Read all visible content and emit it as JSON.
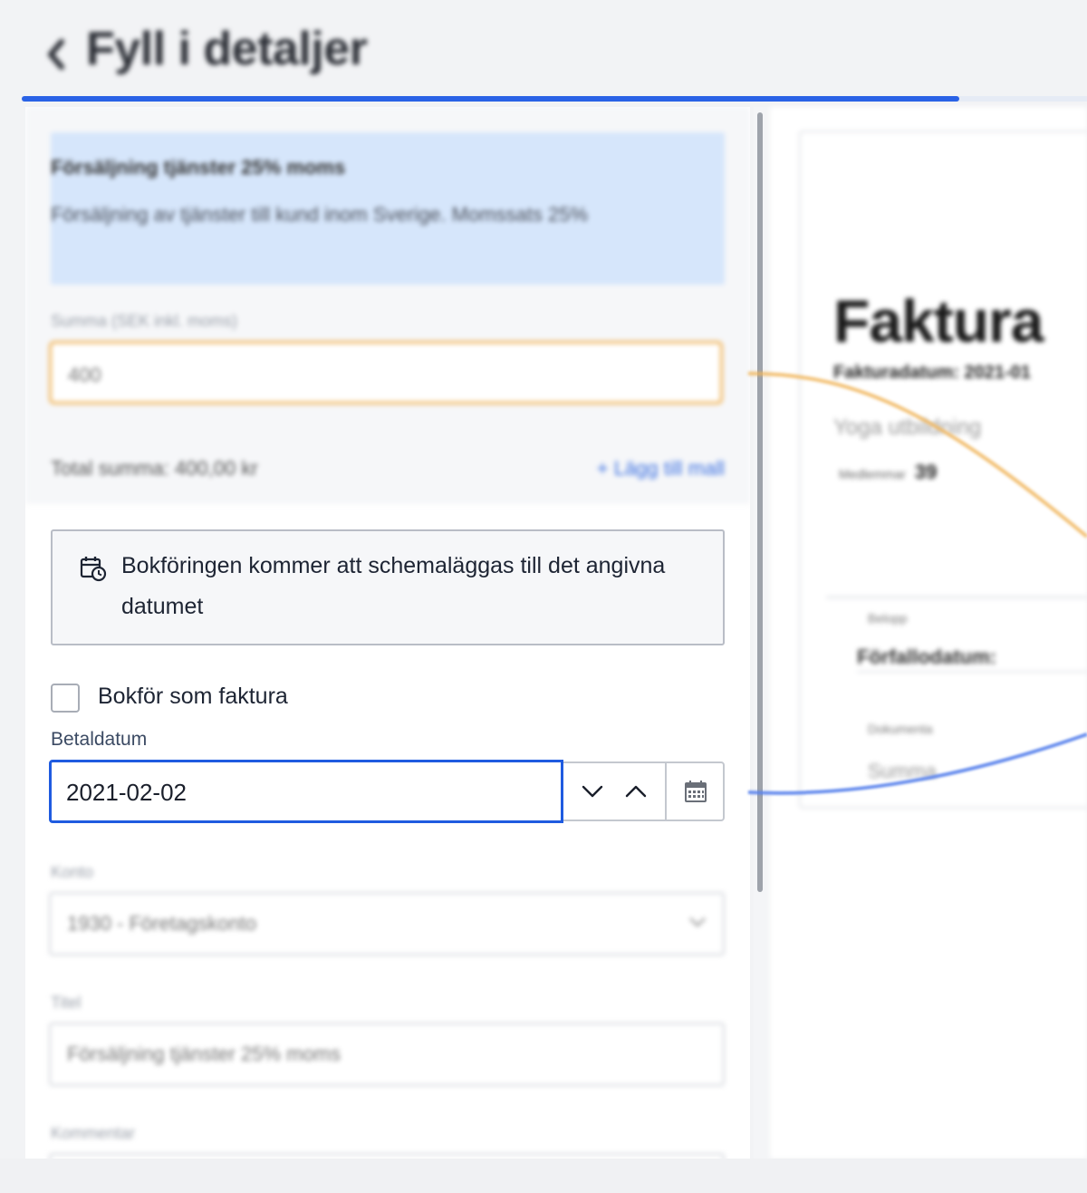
{
  "header": {
    "title": "Fyll i detaljer",
    "progress_percent": 88
  },
  "form": {
    "info_box": {
      "title": "Försäljning tjänster 25% moms",
      "description": "Försäljning av tjänster till kund inom Sverige. Momssats 25%"
    },
    "sum": {
      "label": "Summa (SEK inkl. moms)",
      "value": "400"
    },
    "total_text": "Total summa: 400,00 kr",
    "add_template_label": "+ Lägg till mall",
    "notice": {
      "icon": "calendar-clock-icon",
      "text": "Bokföringen kommer att schemaläggas till det angivna datumet"
    },
    "invoice_checkbox": {
      "label": "Bokför som faktura",
      "checked": false
    },
    "payment_date": {
      "label": "Betaldatum",
      "value": "2021-02-02"
    },
    "account": {
      "label": "Konto",
      "value": "1930 - Företagskonto"
    },
    "title_field": {
      "label": "Titel",
      "value": "Försäljning tjänster 25% moms"
    },
    "comment": {
      "label": "Kommentar"
    }
  },
  "preview": {
    "heading": "Faktura",
    "invoice_date": "Fakturadatum: 2021-01",
    "item": "Yoga utbildning",
    "participants_label": "Medlemmar",
    "participants_value": "39",
    "small_label_1": "Belopp",
    "due_date_label": "Förfallodatum:",
    "small_label_2": "Dokumenta",
    "sum_label": "Summa"
  },
  "colors": {
    "accent_blue": "#2a62e6",
    "highlight_orange": "#f0b55b",
    "info_box_bg": "#d6e6fb"
  }
}
